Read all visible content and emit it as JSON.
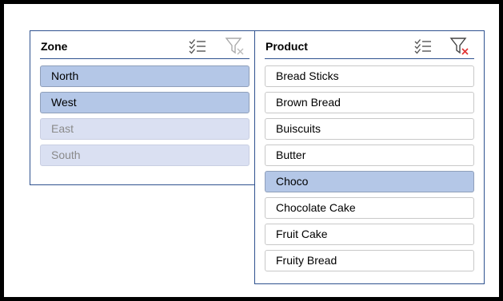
{
  "zone": {
    "title": "Zone",
    "items": [
      {
        "label": "North",
        "state": "selected"
      },
      {
        "label": "West",
        "state": "selected"
      },
      {
        "label": "East",
        "state": "unavailable"
      },
      {
        "label": "South",
        "state": "unavailable"
      }
    ]
  },
  "product": {
    "title": "Product",
    "items": [
      {
        "label": "Bread Sticks",
        "state": "unselected"
      },
      {
        "label": "Brown Bread",
        "state": "unselected"
      },
      {
        "label": "Buiscuits",
        "state": "unselected"
      },
      {
        "label": "Butter",
        "state": "unselected"
      },
      {
        "label": "Choco",
        "state": "selected"
      },
      {
        "label": "Chocolate Cake",
        "state": "unselected"
      },
      {
        "label": "Fruit Cake",
        "state": "unselected"
      },
      {
        "label": "Fruity Bread",
        "state": "unselected"
      }
    ]
  },
  "icons": {
    "multi_select": "multi-select-icon",
    "clear_filter": "clear-filter-icon"
  },
  "colors": {
    "border": "#2f528f",
    "selected_fill": "#b4c7e7",
    "unavailable_fill": "#dae0f2",
    "clear_x_active": "#e03030"
  }
}
